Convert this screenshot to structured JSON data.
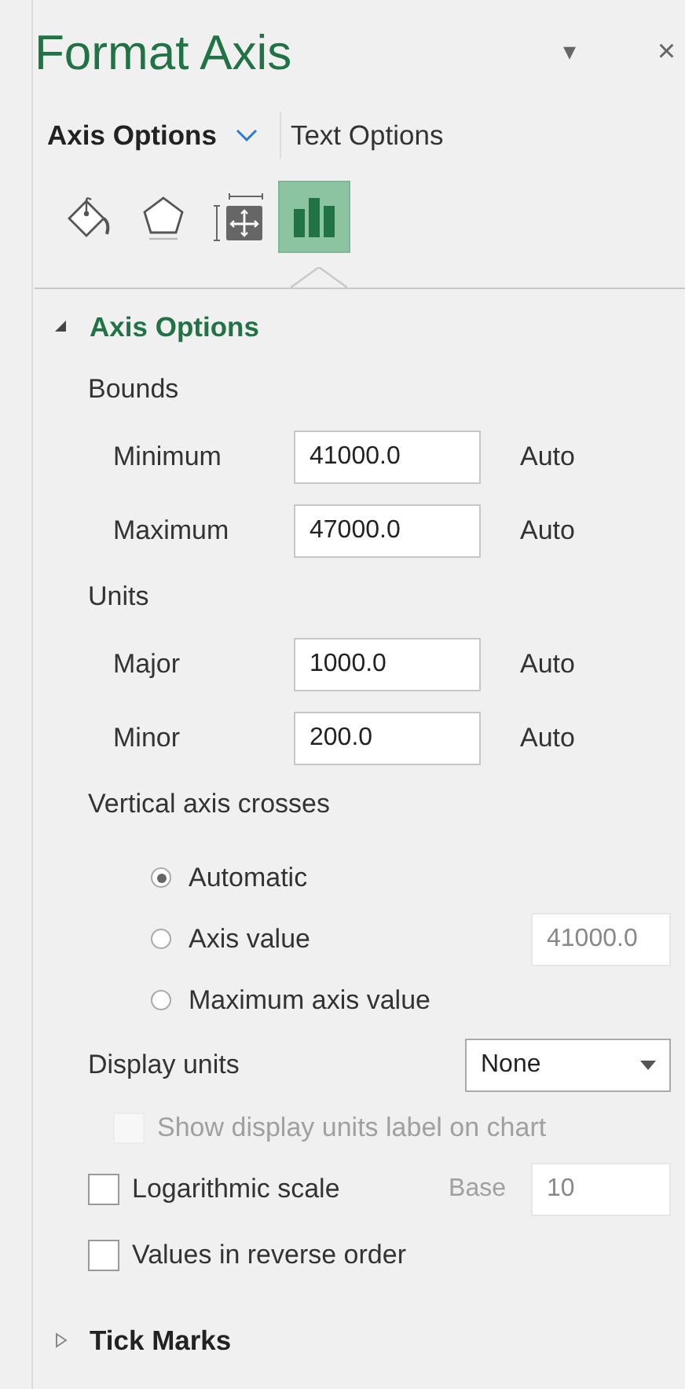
{
  "header": {
    "title": "Format Axis",
    "menu_glyph": "▾",
    "close_glyph": "×"
  },
  "tabs": [
    {
      "label": "Axis Options",
      "selected": true
    },
    {
      "label": "Text Options",
      "selected": false
    }
  ],
  "icon_tabs": [
    {
      "kind": "fill",
      "selected": false
    },
    {
      "kind": "effects",
      "selected": false
    },
    {
      "kind": "size",
      "selected": false
    },
    {
      "kind": "chart",
      "selected": true
    }
  ],
  "sections": [
    {
      "title": "Axis Options",
      "expanded": true,
      "items": [
        {
          "kind": "heading",
          "label": "Bounds"
        },
        {
          "kind": "field",
          "label": "Minimum",
          "value": "41000.0",
          "reset": "Auto"
        },
        {
          "kind": "field",
          "label": "Maximum",
          "value": "47000.0",
          "reset": "Auto"
        },
        {
          "kind": "heading",
          "label": "Units"
        },
        {
          "kind": "field",
          "label": "Major",
          "value": "1000.0",
          "reset": "Auto"
        },
        {
          "kind": "field",
          "label": "Minor",
          "value": "200.0",
          "reset": "Auto"
        },
        {
          "kind": "heading",
          "label": "Vertical axis crosses"
        },
        {
          "kind": "radio",
          "label": "Automatic",
          "selected": true
        },
        {
          "kind": "radio",
          "label": "Axis value",
          "selected": false,
          "value": "41000.0",
          "value_disabled": true
        },
        {
          "kind": "radio",
          "label": "Maximum axis value",
          "selected": false
        },
        {
          "kind": "dropdown",
          "label": "Display units",
          "value": "None",
          "children": [
            {
              "kind": "checkbox",
              "label": "Show display units label on chart",
              "checked": false,
              "disabled": true
            }
          ]
        },
        {
          "kind": "checkbox",
          "label": "Logarithmic scale",
          "checked": false,
          "disabled": false,
          "base": {
            "label": "Base",
            "value": "10",
            "disabled": true
          }
        },
        {
          "kind": "checkbox",
          "label": "Values in reverse order",
          "checked": false,
          "disabled": false
        }
      ]
    },
    {
      "title": "Tick Marks",
      "expanded": false
    }
  ]
}
